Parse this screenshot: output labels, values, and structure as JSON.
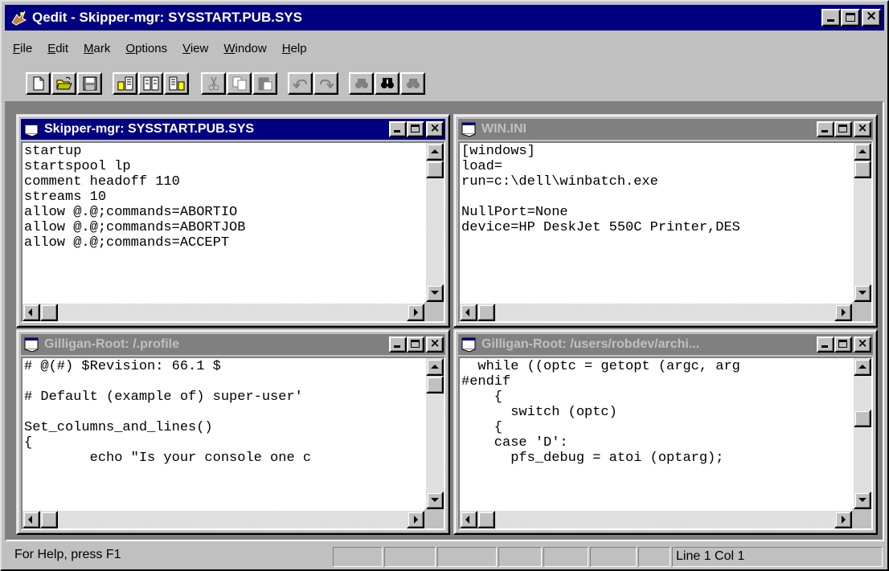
{
  "window": {
    "title": "Qedit - Skipper-mgr: SYSSTART.PUB.SYS",
    "controls": [
      "minimize",
      "maximize",
      "close"
    ]
  },
  "menu": [
    {
      "underline": "F",
      "rest": "ile"
    },
    {
      "underline": "E",
      "rest": "dit"
    },
    {
      "underline": "M",
      "rest": "ark"
    },
    {
      "underline": "O",
      "rest": "ptions"
    },
    {
      "underline": "V",
      "rest": "iew"
    },
    {
      "underline": "W",
      "rest": "indow"
    },
    {
      "underline": "H",
      "rest": "elp"
    }
  ],
  "toolbar": {
    "icons": [
      "new-file-icon",
      "open-folder-icon",
      "save-disk-icon",
      "host-connect-icon",
      "host-transfer-icon",
      "host-disconnect-icon",
      "cut-icon",
      "copy-icon",
      "paste-icon",
      "undo-icon",
      "redo-icon",
      "find-previous-icon",
      "find-binoculars-icon",
      "find-next-icon"
    ]
  },
  "children": [
    {
      "title": "Skipper-mgr: SYSSTART.PUB.SYS",
      "active": true,
      "lines": [
        "startup",
        "startspool lp",
        "comment headoff 110",
        "streams 10",
        "allow @.@;commands=ABORTIO",
        "allow @.@;commands=ABORTJOB",
        "allow @.@;commands=ACCEPT"
      ]
    },
    {
      "title": "WIN.INI",
      "active": false,
      "lines": [
        "[windows]",
        "load=",
        "run=c:\\dell\\winbatch.exe",
        "",
        "NullPort=None",
        "device=HP DeskJet 550C Printer,DES"
      ]
    },
    {
      "title": "Gilligan-Root: /.profile",
      "active": false,
      "lines": [
        "# @(#) $Revision: 66.1 $",
        "",
        "# Default (example of) super-user'",
        "",
        "Set_columns_and_lines()",
        "{",
        "        echo \"Is your console one c"
      ]
    },
    {
      "title": "Gilligan-Root: /users/robdev/archi...",
      "active": false,
      "lines": [
        "  while ((optc = getopt (argc, arg",
        "#endif",
        "    {",
        "      switch (optc)",
        "    {",
        "    case 'D':",
        "      pfs_debug = atoi (optarg);"
      ]
    }
  ],
  "status": {
    "help": "For Help, press F1",
    "position": "Line 1 Col 1"
  },
  "colors": {
    "active_caption": "#000080",
    "inactive_caption": "#808080",
    "face": "#c0c0c0",
    "editor_bg": "#ffffff"
  }
}
